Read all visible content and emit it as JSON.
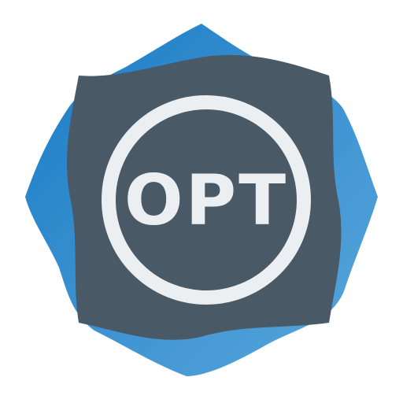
{
  "app_icon": {
    "name": "OPT",
    "label": "OPT",
    "colors": {
      "background": "#ffffff",
      "back_shape_dark": "#1b7cc5",
      "back_shape_light": "#5aa7dc",
      "front_shape": "#4a5966",
      "ring": "#eceff1",
      "text": "#eceff1"
    }
  }
}
